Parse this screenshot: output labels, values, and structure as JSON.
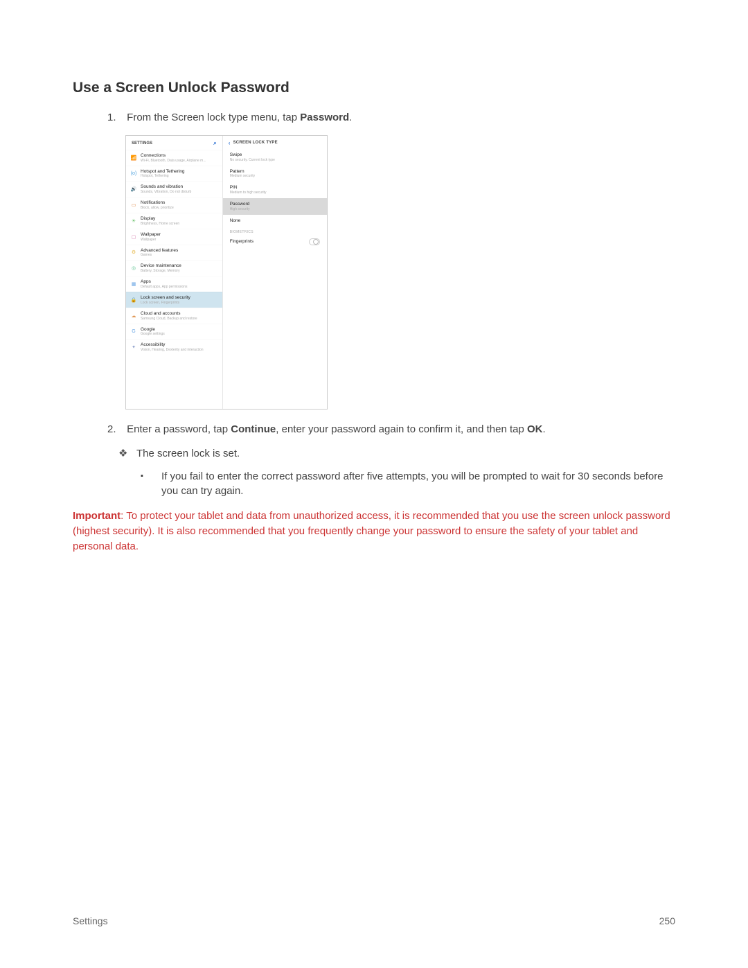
{
  "heading": "Use a Screen Unlock Password",
  "step1_pre": "From the Screen lock type menu, tap ",
  "step1_bold": "Password",
  "step1_post": ".",
  "step2_a": "Enter a password, tap ",
  "step2_bold1": "Continue",
  "step2_b": ", enter your password again to confirm it, and then tap ",
  "step2_bold2": "OK",
  "step2_c": ".",
  "diamond1": "The screen lock is set.",
  "square1": "If you fail to enter the correct password after five attempts, you will be prompted to wait for 30 seconds before you can try again.",
  "important_label": "Important",
  "important_text": ": To protect your tablet and data from unauthorized access, it is recommended that you use the screen unlock password (highest security). It is also recommended that you frequently change your password to ensure the safety of your tablet and personal data.",
  "footer_left": "Settings",
  "footer_right": "250",
  "mock": {
    "settings_label": "SETTINGS",
    "right_header": "SCREEN LOCK TYPE",
    "left": [
      {
        "icon": "📶",
        "color": "#4aa0de",
        "title": "Connections",
        "sub": "Wi-Fi, Bluetooth, Data usage, Airplane m..."
      },
      {
        "icon": "(o)",
        "color": "#4aa0de",
        "title": "Hotspot and Tethering",
        "sub": "Hotspot, Tethering"
      },
      {
        "icon": "🔊",
        "color": "#4aa0de",
        "title": "Sounds and vibration",
        "sub": "Sounds, Vibration, Do not disturb"
      },
      {
        "icon": "▭",
        "color": "#e08a4a",
        "title": "Notifications",
        "sub": "Block, allow, prioritize"
      },
      {
        "icon": "☀",
        "color": "#6cc26c",
        "title": "Display",
        "sub": "Brightness, Home screen"
      },
      {
        "icon": "▢",
        "color": "#d67fb0",
        "title": "Wallpaper",
        "sub": "Wallpaper"
      },
      {
        "icon": "⚙",
        "color": "#e6b84a",
        "title": "Advanced features",
        "sub": "Games"
      },
      {
        "icon": "◎",
        "color": "#5bc28f",
        "title": "Device maintenance",
        "sub": "Battery, Storage, Memory"
      },
      {
        "icon": "▦",
        "color": "#6aa6e4",
        "title": "Apps",
        "sub": "Default apps, App permissions"
      },
      {
        "icon": "🔒",
        "color": "#5bc2c2",
        "title": "Lock screen and security",
        "sub": "Lock screen, Fingerprints",
        "selected": true
      },
      {
        "icon": "☁",
        "color": "#e09a5a",
        "title": "Cloud and accounts",
        "sub": "Samsung Cloud, Backup and restore"
      },
      {
        "icon": "G",
        "color": "#6aa6e4",
        "title": "Google",
        "sub": "Google settings"
      },
      {
        "icon": "✦",
        "color": "#8a9cc9",
        "title": "Accessibility",
        "sub": "Vision, Hearing, Dexterity and interaction"
      }
    ],
    "right": [
      {
        "title": "Swipe",
        "sub": "No security. Current lock type"
      },
      {
        "title": "Pattern",
        "sub": "Medium security"
      },
      {
        "title": "PIN",
        "sub": "Medium to high security"
      },
      {
        "title": "Password",
        "sub": "High security",
        "selected": true
      },
      {
        "title": "None",
        "sub": ""
      }
    ],
    "biometrics_label": "BIOMETRICS",
    "fingerprints": "Fingerprints"
  }
}
